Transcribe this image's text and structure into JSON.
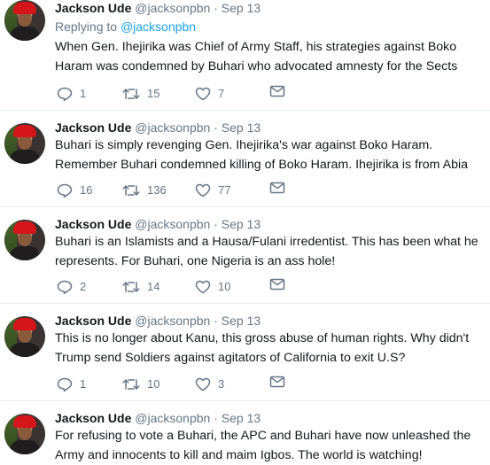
{
  "tweets": [
    {
      "name": "Jackson Ude",
      "handle": "@jacksonpbn",
      "sep": "·",
      "date": "Sep 13",
      "replying_prefix": "Replying to",
      "replying_mention": "@jacksonpbn",
      "text": "When Gen. Ihejirika was Chief of Army Staff, his strategies against Boko Haram was condemned by Buhari who advocated amnesty for the Sects",
      "replies": "1",
      "retweets": "15",
      "likes": "7"
    },
    {
      "name": "Jackson Ude",
      "handle": "@jacksonpbn",
      "sep": "·",
      "date": "Sep 13",
      "text": "Buhari is simply revenging Gen. Ihejirika's war against Boko Haram. Remember Buhari condemned killing of Boko Haram. Ihejirika is from Abia",
      "replies": "16",
      "retweets": "136",
      "likes": "77"
    },
    {
      "name": "Jackson Ude",
      "handle": "@jacksonpbn",
      "sep": "·",
      "date": "Sep 13",
      "text": "Buhari is an Islamists and a Hausa/Fulani irredentist. This has been what he represents. For Buhari, one Nigeria is an ass hole!",
      "replies": "2",
      "retweets": "14",
      "likes": "10"
    },
    {
      "name": "Jackson Ude",
      "handle": "@jacksonpbn",
      "sep": "·",
      "date": "Sep 13",
      "text": "This is no longer about Kanu, this gross abuse of human rights. Why didn't Trump send Soldiers against agitators of California to exit U.S?",
      "replies": "1",
      "retweets": "10",
      "likes": "3"
    },
    {
      "name": "Jackson Ude",
      "handle": "@jacksonpbn",
      "sep": "·",
      "date": "Sep 13",
      "text": "For refusing to vote a Buhari, the APC and Buhari have now unleashed the Army and innocents to kill and maim Igbos. The world is watching!"
    }
  ],
  "icons": {
    "reply": "reply-icon",
    "retweet": "retweet-icon",
    "like": "heart-icon",
    "message": "envelope-icon"
  },
  "colors": {
    "text": "#14171a",
    "muted": "#657786",
    "link": "#1da1f2",
    "divider": "#e6ecf0"
  }
}
